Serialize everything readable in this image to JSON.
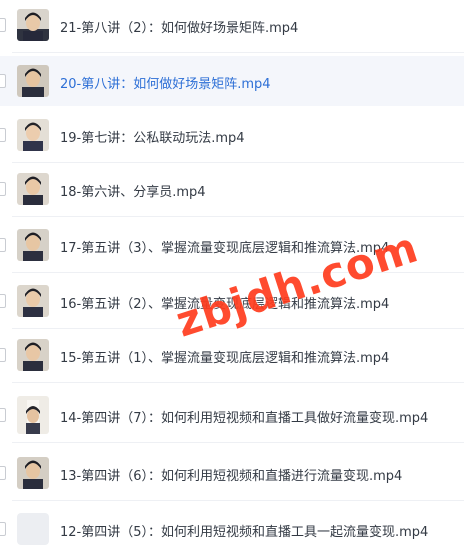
{
  "files": [
    {
      "name": "21-第八讲（2）：如何做好场景矩阵.mp4",
      "selected": false,
      "thumb": "person-thumbnail"
    },
    {
      "name": "20-第八讲：如何做好场景矩阵.mp4",
      "selected": true,
      "thumb": "person-thumbnail"
    },
    {
      "name": "19-第七讲：公私联动玩法.mp4",
      "selected": false,
      "thumb": "person-thumbnail"
    },
    {
      "name": "18-第六讲、分享员.mp4",
      "selected": false,
      "thumb": "person-thumbnail"
    },
    {
      "name": "17-第五讲（3）、掌握流量变现底层逻辑和推流算法.mp4",
      "selected": false,
      "thumb": "person-thumbnail"
    },
    {
      "name": "16-第五讲（2）、掌握流量变现底层逻辑和推流算法.mp4",
      "selected": false,
      "thumb": "person-thumbnail"
    },
    {
      "name": "15-第五讲（1）、掌握流量变现底层逻辑和推流算法.mp4",
      "selected": false,
      "thumb": "person-thumbnail"
    },
    {
      "name": "14-第四讲（7）：如何利用短视频和直播工具做好流量变现.mp4",
      "selected": false,
      "thumb": "person-thumbnail"
    },
    {
      "name": "13-第四讲（6）：如何利用短视频和直播进行流量变现.mp4",
      "selected": false,
      "thumb": "person-thumbnail"
    },
    {
      "name": "12-第四讲（5）：如何利用短视频和直播工具一起流量变现.mp4",
      "selected": false,
      "thumb": "blank-thumbnail"
    }
  ],
  "watermark": "zbjdh.com",
  "colors": {
    "selected_text": "#2d6fd6",
    "text": "#333a44",
    "selected_bg": "#f4f6fb",
    "watermark": "#ff3c1e"
  }
}
